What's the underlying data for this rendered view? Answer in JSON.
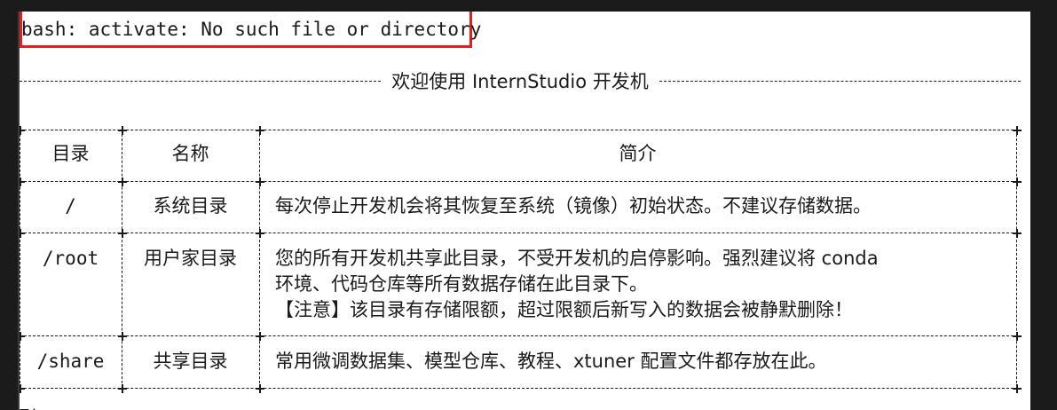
{
  "terminal": {
    "error_line": "bash: activate: No such file or directory",
    "banner": "欢迎使用 InternStudio 开发机",
    "table": {
      "headers": [
        "目录",
        "名称",
        "简介"
      ],
      "rows": [
        {
          "dir": "/",
          "name": "系统目录",
          "desc": [
            "每次停止开发机会将其恢复至系统（镜像）初始状态。不建议存储数据。"
          ]
        },
        {
          "dir": "/root",
          "name": "用户家目录",
          "desc": [
            "您的所有开发机共享此目录，不受开发机的启停影响。强烈建议将 conda",
            "环境、代码仓库等所有数据存储在此目录下。",
            "【注意】该目录有存储限额，超过限额后新写入的数据会被静默删除！"
          ]
        },
        {
          "dir": "/share",
          "name": "共享目录",
          "desc": [
            "常用微调数据集、模型仓库、教程、xtuner 配置文件都存放在此。"
          ]
        }
      ]
    },
    "cutoff_line": "Ti"
  },
  "colors": {
    "background": "#ffffff",
    "frame": "#1b1b1b",
    "highlight": "#e02020",
    "text": "#1a1a1a"
  }
}
